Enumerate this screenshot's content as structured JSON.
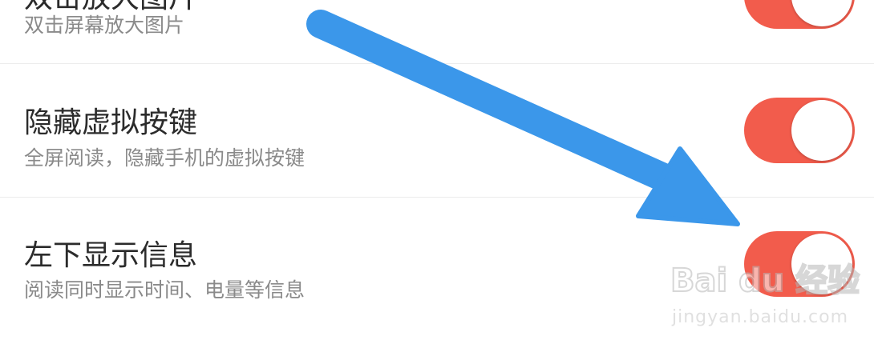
{
  "colors": {
    "toggle_on": "#f25c4c",
    "arrow": "#3b97ea",
    "title_text": "#2b2b2b",
    "subtitle_text": "#8a8a8a"
  },
  "settings": {
    "items": [
      {
        "title": "双击放大图片",
        "subtitle": "双击屏幕放大图片",
        "enabled": true
      },
      {
        "title": "隐藏虚拟按键",
        "subtitle": "全屏阅读，隐藏手机的虚拟按键",
        "enabled": true
      },
      {
        "title": "左下显示信息",
        "subtitle": "阅读同时显示时间、电量等信息",
        "enabled": true
      }
    ]
  },
  "annotation": {
    "icon": "arrow-pointer-icon"
  },
  "watermark": {
    "brand": "Bai du 经验",
    "url": "jingyan.baidu.com"
  }
}
